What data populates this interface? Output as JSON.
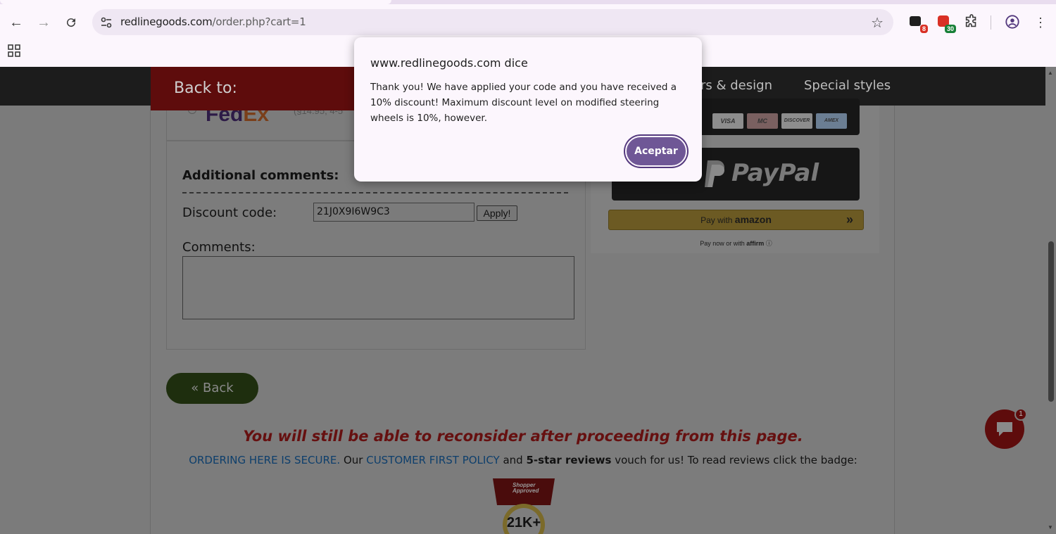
{
  "browser": {
    "url_host": "redlinegoods.com",
    "url_path": "/order.php?cart=1",
    "extensions": [
      {
        "name": "extension-a",
        "badge": "8",
        "badge_color": "#d93025"
      },
      {
        "name": "extension-b",
        "badge": "30",
        "badge_color": "#188038"
      }
    ]
  },
  "site_nav": {
    "back_to": "Back to:",
    "menu": [
      "rs & design",
      "Special styles"
    ]
  },
  "shipping": {
    "carrier_fed": "Fed",
    "carrier_ex": "Ex",
    "price_partial": "(§14.95, 4-5"
  },
  "form": {
    "additional_comments_label": "Additional comments:",
    "discount_label": "Discount code:",
    "discount_value": "21J0X9I6W9C3",
    "apply_label": "Apply!",
    "comments_label": "Comments:"
  },
  "back_button": "« Back",
  "reconsider_text": "You will still be able to reconsider after proceeding from this page.",
  "secure": {
    "link1": "ORDERING HERE IS SECURE.",
    "text1": " Our ",
    "link2": "CUSTOMER FIRST POLICY",
    "text2": " and ",
    "bold": "5-star reviews",
    "text3": " vouch for us! To read reviews click the badge:"
  },
  "shopper_badge": {
    "label": "Shopper Approved",
    "count": "21K+"
  },
  "payment": {
    "cards": [
      "VISA",
      "MC",
      "DISCOVER",
      "AMEX"
    ],
    "paypal": "PayPal",
    "amazon_prefix": "Pay with ",
    "amazon_brand": "amazon",
    "affirm_prefix": "Pay now or with ",
    "affirm_brand": "affirm"
  },
  "chat": {
    "badge": "1"
  },
  "dialog": {
    "title": "www.redlinegoods.com dice",
    "message": "Thank you! We have applied your code and you have received a 10% discount! Maximum discount level on modified steering wheels is 10%, however.",
    "ok_label": "Aceptar"
  }
}
